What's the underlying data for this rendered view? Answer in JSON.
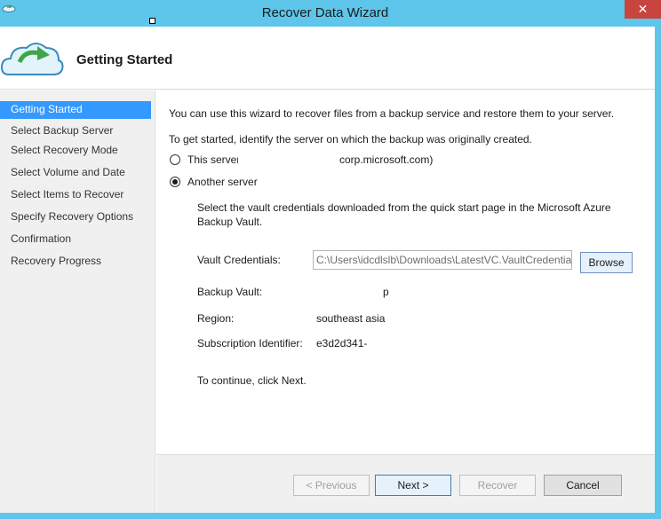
{
  "window": {
    "title": "Recover Data Wizard",
    "close_label": "✕"
  },
  "header": {
    "title": "Getting Started"
  },
  "nav": {
    "items": [
      "Getting Started",
      "Select Backup Server",
      "Select Recovery Mode",
      "Select Volume and Date",
      "Select Items to Recover",
      "Specify Recovery Options",
      "Confirmation",
      "Recovery Progress"
    ],
    "active_index": 0
  },
  "content": {
    "intro": "You can use this wizard to recover files from a backup service and restore them to your server.",
    "identify": "To get started, identify the server on which the backup was originally created.",
    "option_this_server": "This server (",
    "option_this_server_suffix": "corp.microsoft.com)",
    "option_another_server": "Another server",
    "selected_option": "Another server",
    "vault_instructions_line1": "Select the vault credentials downloaded from the quick start page in the Microsoft Azure",
    "vault_instructions_line2": "Backup Vault.",
    "vault_credentials_label": "Vault Credentials:",
    "vault_credentials_value": "C:\\Users\\idcdlslb\\Downloads\\LatestVC.VaultCredentials",
    "browse_label": "Browse",
    "backup_vault_label": "Backup Vault:",
    "backup_vault_value": "p",
    "region_label": "Region:",
    "region_value": "southeast asia",
    "subscription_label": "Subscription Identifier:",
    "subscription_value": "e3d2d341-",
    "continue_text": "To continue, click Next."
  },
  "footer": {
    "previous_label": "< Previous",
    "next_label": "Next >",
    "recover_label": "Recover",
    "cancel_label": "Cancel"
  },
  "colors": {
    "title_bar": "#5dc6ea",
    "close_button": "#c7443f",
    "nav_active": "#3399ff",
    "nav_background": "#f0f0f0"
  },
  "icons": {
    "app": "cloud-recover-icon",
    "header": "cloud-recover-icon",
    "close": "close-icon"
  }
}
